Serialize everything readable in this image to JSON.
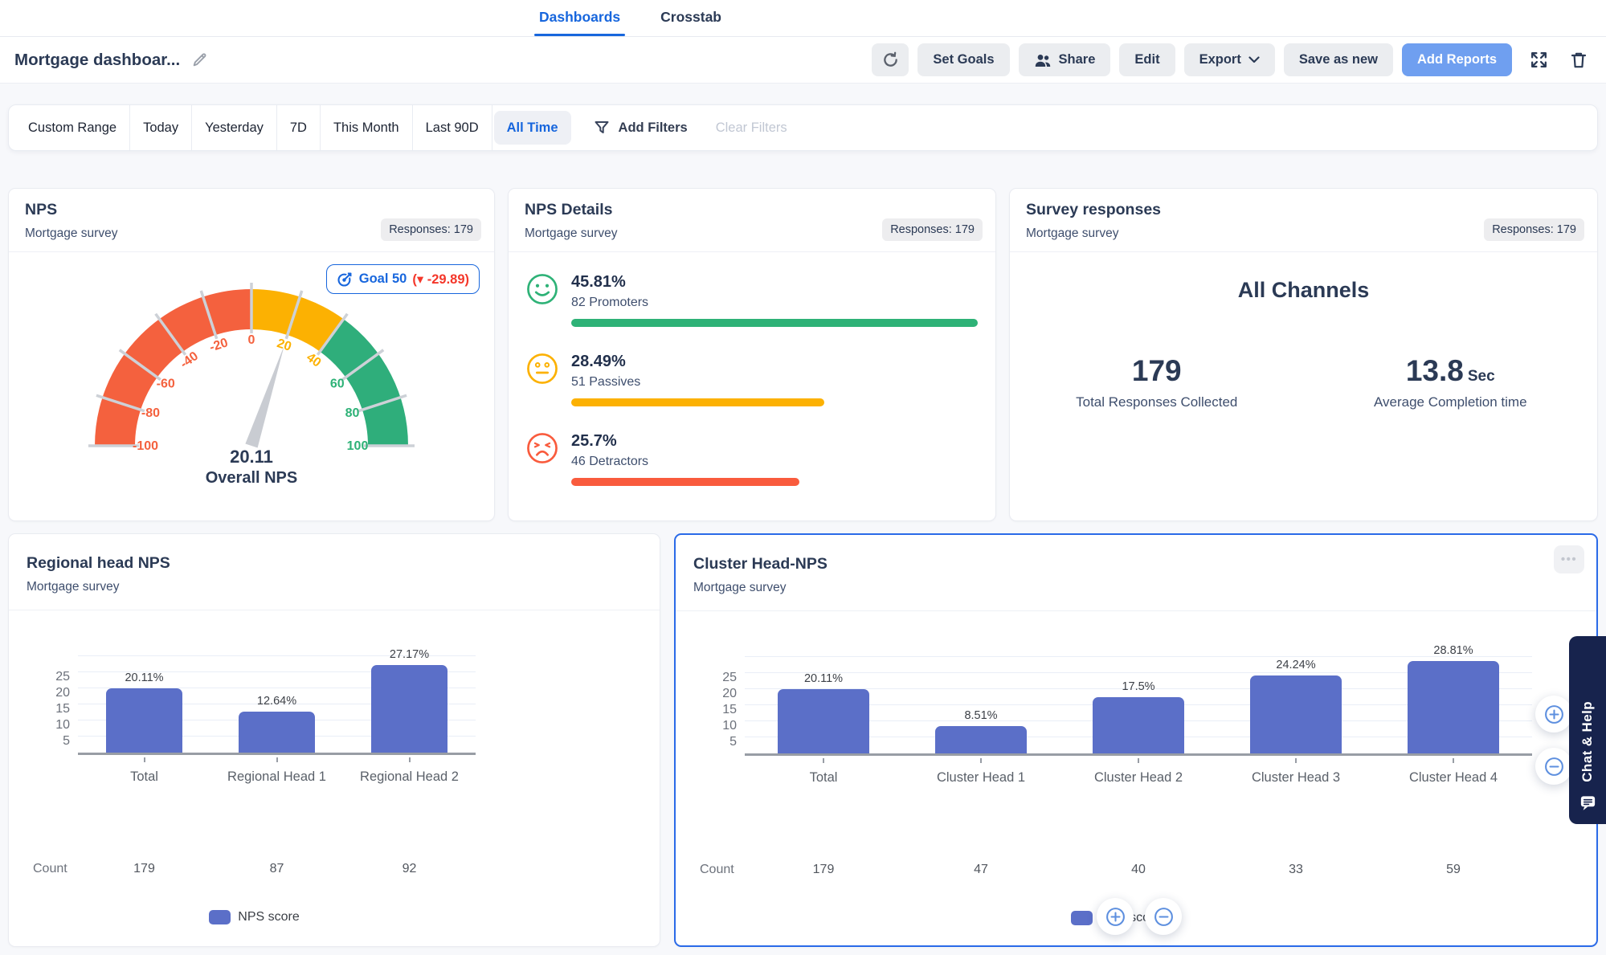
{
  "topbar": {
    "tabs": [
      {
        "label": "Dashboards",
        "active": true
      },
      {
        "label": "Crosstab",
        "active": false
      }
    ]
  },
  "toolbar": {
    "title": "Mortgage dashboar...",
    "buttons": {
      "set_goals": "Set Goals",
      "share": "Share",
      "edit": "Edit",
      "export": "Export",
      "save_as_new": "Save as new",
      "add_reports": "Add Reports"
    }
  },
  "filter_bar": {
    "ranges": [
      "Custom Range",
      "Today",
      "Yesterday",
      "7D",
      "This Month",
      "Last 90D",
      "All Time"
    ],
    "active_range": "All Time",
    "add_filters_label": "Add Filters",
    "clear_filters_label": "Clear Filters"
  },
  "cards": {
    "nps": {
      "title": "NPS",
      "subtitle": "Mortgage survey",
      "responses_badge": "Responses: 179",
      "goal": {
        "label": "Goal 50",
        "delta_text": "(▾ -29.89)"
      },
      "gauge": {
        "min": -100,
        "max": 100,
        "value": 20.11,
        "value_label": "20.11",
        "caption": "Overall NPS",
        "tick_labels": [
          -100,
          -80,
          -60,
          -40,
          -20,
          0,
          20,
          40,
          60,
          80,
          100
        ],
        "segments": [
          {
            "from": -100,
            "to": 0,
            "color": "#f4613e"
          },
          {
            "from": 0,
            "to": 40,
            "color": "#fcb102"
          },
          {
            "from": 40,
            "to": 100,
            "color": "#2fae7b"
          }
        ]
      }
    },
    "nps_details": {
      "title": "NPS Details",
      "subtitle": "Mortgage survey",
      "responses_badge": "Responses: 179",
      "bar_max": 45.81,
      "rows": [
        {
          "icon": "happy-face-icon",
          "pct_label": "45.81%",
          "count_label": "82 Promoters",
          "value": 45.81,
          "color": "#2eb277"
        },
        {
          "icon": "neutral-face-icon",
          "pct_label": "28.49%",
          "count_label": "51 Passives",
          "value": 28.49,
          "color": "#fcb102"
        },
        {
          "icon": "angry-face-icon",
          "pct_label": "25.7%",
          "count_label": "46 Detractors",
          "value": 25.7,
          "color": "#f95b3d"
        }
      ]
    },
    "survey_responses": {
      "title": "Survey responses",
      "subtitle": "Mortgage survey",
      "responses_badge": "Responses: 179",
      "channel": "All Channels",
      "stats": [
        {
          "value": "179",
          "unit": "",
          "caption": "Total Responses Collected"
        },
        {
          "value": "13.8",
          "unit": "Sec",
          "caption": "Average Completion time"
        }
      ]
    },
    "regional": {
      "title": "Regional head NPS",
      "subtitle": "Mortgage survey",
      "count_label": "Count",
      "legend": "NPS score",
      "chart": {
        "type": "bar",
        "y_ticks": [
          5,
          10,
          15,
          20,
          25
        ],
        "categories": [
          "Total",
          "Regional Head 1",
          "Regional Head 2"
        ],
        "values": [
          20.11,
          12.64,
          27.17
        ],
        "value_labels": [
          "20.11%",
          "12.64%",
          "27.17%"
        ],
        "counts": [
          "179",
          "87",
          "92"
        ]
      }
    },
    "cluster": {
      "title": "Cluster Head-NPS",
      "subtitle": "Mortgage survey",
      "count_label": "Count",
      "legend": "NPS score",
      "chart": {
        "type": "bar",
        "y_ticks": [
          5,
          10,
          15,
          20,
          25
        ],
        "categories": [
          "Total",
          "Cluster Head 1",
          "Cluster Head 2",
          "Cluster Head 3",
          "Cluster Head 4"
        ],
        "values": [
          20.11,
          8.51,
          17.5,
          24.24,
          28.81
        ],
        "value_labels": [
          "20.11%",
          "8.51%",
          "17.5%",
          "24.24%",
          "28.81%"
        ],
        "counts": [
          "179",
          "47",
          "40",
          "33",
          "59"
        ]
      }
    }
  },
  "chat_help": {
    "label": "Chat & Help"
  },
  "icons": {
    "more_dots": "•••"
  },
  "colors": {
    "accent": "#1766dd",
    "bar": "#5b6fc8",
    "green": "#2eb277",
    "amber": "#fcb102",
    "red": "#f4613e",
    "navy": "#2b3a55",
    "needle": "#c9ccd2",
    "add_reports_bg": "#6f9ff0"
  }
}
